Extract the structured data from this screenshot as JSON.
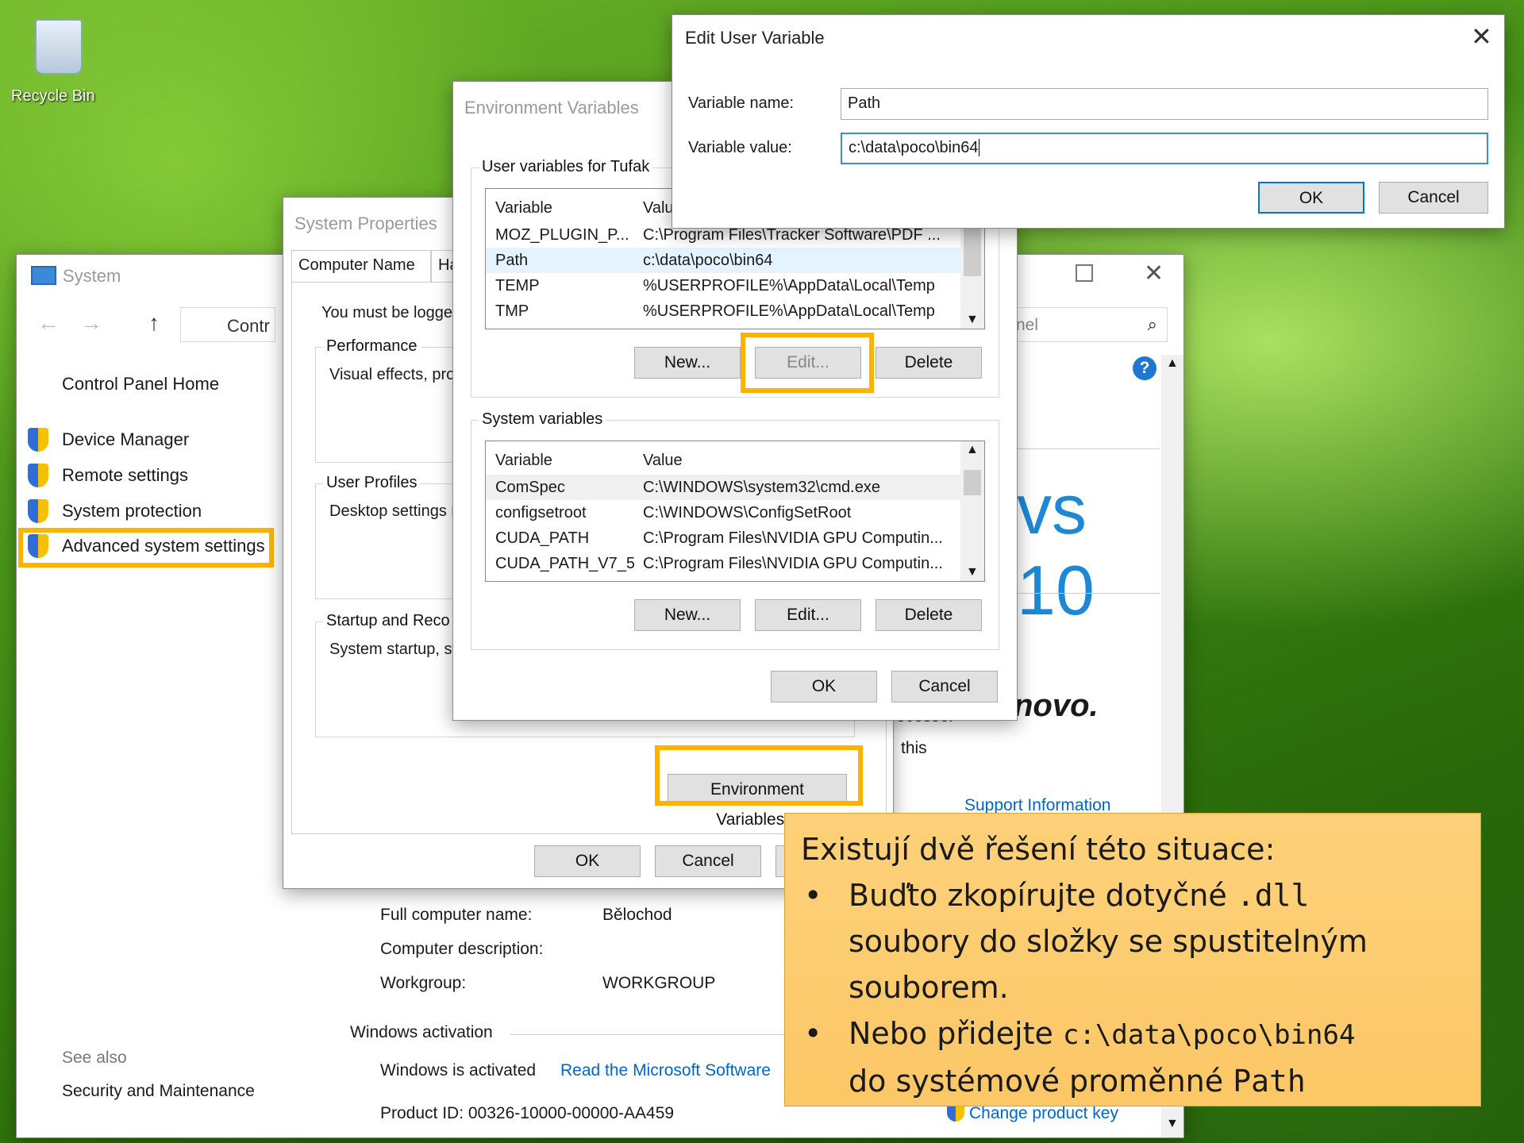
{
  "desktop": {
    "recycle_bin": "Recycle Bin"
  },
  "system": {
    "title": "System",
    "breadcrumb": "Contr",
    "search_fragment": "nel",
    "nav": [
      "Control Panel Home",
      "Device Manager",
      "Remote settings",
      "System protection",
      "Advanced system settings"
    ],
    "see_also": "See also",
    "see_also_link": "Security and Maintenance",
    "brand": "vs 10",
    "oem": "novo.",
    "fragment_processor": "ocessor",
    "fragment_this": "this",
    "support": "Support Information",
    "rows": [
      {
        "label": "Full computer name:",
        "value": "Bělochod"
      },
      {
        "label": "Computer description:",
        "value": ""
      },
      {
        "label": "Workgroup:",
        "value": "WORKGROUP"
      }
    ],
    "activation_header": "Windows activation",
    "activated": "Windows is activated",
    "license_link": "Read the Microsoft Software",
    "product_id": "Product ID: 00326-10000-00000-AA459",
    "change_key": "Change product key"
  },
  "sysprops": {
    "title": "System Properties",
    "tab1": "Computer Name",
    "tab2": "Ha",
    "logged": "You must be logged",
    "perf": "Performance",
    "perf_text": "Visual effects, pro",
    "profiles": "User Profiles",
    "profiles_text": "Desktop settings r",
    "startup": "Startup and Reco",
    "startup_text": "System startup, sy",
    "env_btn": "Environment Variables...",
    "ok": "OK",
    "cancel": "Cancel"
  },
  "envvars": {
    "title": "Environment Variables",
    "user_group": "User variables for Tufak",
    "col_var": "Variable",
    "col_val": "Value",
    "col_val_short": "Valu",
    "user_vars": [
      {
        "name": "MOZ_PLUGIN_P...",
        "value": "C:\\Program Files\\Tracker Software\\PDF ..."
      },
      {
        "name": "Path",
        "value": "c:\\data\\poco\\bin64"
      },
      {
        "name": "TEMP",
        "value": "%USERPROFILE%\\AppData\\Local\\Temp"
      },
      {
        "name": "TMP",
        "value": "%USERPROFILE%\\AppData\\Local\\Temp"
      }
    ],
    "sys_group": "System variables",
    "sys_vars": [
      {
        "name": "ComSpec",
        "value": "C:\\WINDOWS\\system32\\cmd.exe"
      },
      {
        "name": "configsetroot",
        "value": "C:\\WINDOWS\\ConfigSetRoot"
      },
      {
        "name": "CUDA_PATH",
        "value": "C:\\Program Files\\NVIDIA GPU Computin..."
      },
      {
        "name": "CUDA_PATH_V7_5",
        "value": "C:\\Program Files\\NVIDIA GPU Computin..."
      }
    ],
    "new": "New...",
    "edit": "Edit...",
    "delete": "Delete",
    "ok": "OK",
    "cancel": "Cancel"
  },
  "editvar": {
    "title": "Edit User Variable",
    "name_label": "Variable name:",
    "name_value": "Path",
    "value_label": "Variable value:",
    "value_value": "c:\\data\\poco\\bin64",
    "ok": "OK",
    "cancel": "Cancel"
  },
  "callout": {
    "heading": "Existují dvě řešení této situace:",
    "b1a": "Buďto zkopírujte dotyčné ",
    "b1code": ".dll",
    "b1b": "soubory do složky se spustitelným souborem.",
    "b2a": "Nebo přidejte ",
    "b2code": "c:\\data\\poco\\bin64",
    "b2b": "do systémové proměnné ",
    "b2code2": "Path"
  },
  "colors": {
    "highlight": "#ffb300",
    "callout_bg": "#fdd17a",
    "link": "#0066cc"
  }
}
